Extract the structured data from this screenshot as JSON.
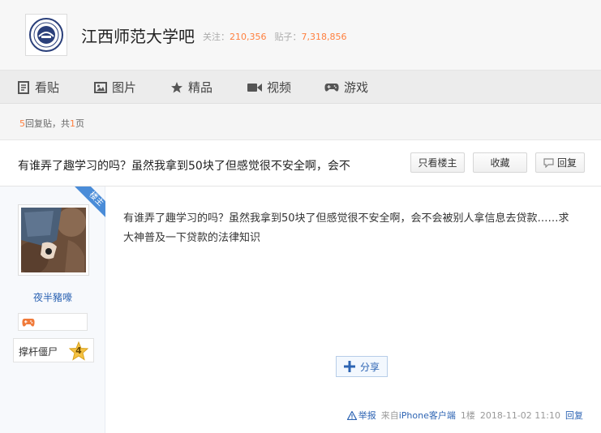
{
  "forum": {
    "name": "江西师范大学吧",
    "follow_label": "关注：",
    "follow_count": "210,356",
    "posts_label": "贴子：",
    "posts_count": "7,318,856"
  },
  "nav": {
    "items": [
      {
        "label": "看贴",
        "icon": "document-icon"
      },
      {
        "label": "图片",
        "icon": "image-icon"
      },
      {
        "label": "精品",
        "icon": "star-icon"
      },
      {
        "label": "视频",
        "icon": "video-icon"
      },
      {
        "label": "游戏",
        "icon": "gamepad-icon"
      }
    ]
  },
  "reply_info": {
    "count": "5",
    "count_suffix": "回复贴，共",
    "pages": "1",
    "pages_suffix": "页"
  },
  "thread": {
    "title": "有谁弄了趣学习的吗？虽然我拿到50块了但感觉很不安全啊，会不",
    "only_author_label": "只看楼主",
    "favorite_label": "收藏",
    "reply_label": "回复"
  },
  "post": {
    "author": "夜半豬嚎",
    "ribbon_label": "楼主",
    "level_name": "撑杆僵尸",
    "level_num": "4",
    "content": "有谁弄了趣学习的吗？虽然我拿到50块了但感觉很不安全啊，会不会被别人拿信息去贷款……求大神普及一下贷款的法律知识",
    "share_label": "分享",
    "report_label": "举报",
    "from_prefix": "来自",
    "from_client": "iPhone客户端",
    "floor": "1楼",
    "timestamp": "2018-11-02 11:10",
    "reply_label": "回复"
  },
  "colors": {
    "accent_orange": "#ff7f3e",
    "link_blue": "#2d64b3",
    "ribbon_blue": "#4a8cd8"
  }
}
